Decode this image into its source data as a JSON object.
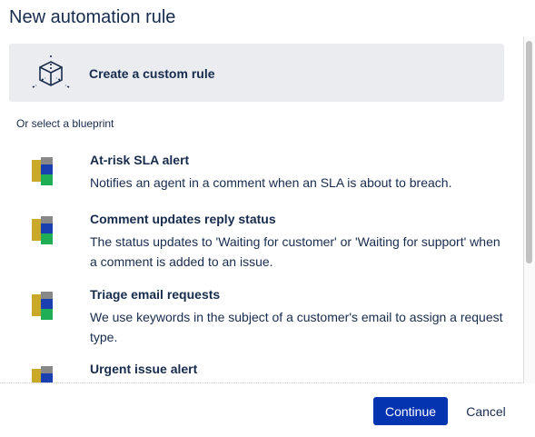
{
  "title": "New automation rule",
  "custom_rule": "Create a custom rule",
  "blueprint_label": "Or select a blueprint",
  "blueprints": [
    {
      "title": "At-risk SLA alert",
      "desc": "Notifies an agent in a comment when an SLA is about to breach."
    },
    {
      "title": "Comment updates reply status",
      "desc": "The status updates to 'Waiting for customer' or 'Waiting for support' when a comment is added to an issue."
    },
    {
      "title": "Triage email requests",
      "desc": "We use keywords in the subject of a customer's email to assign a request type."
    },
    {
      "title": "Urgent issue alert",
      "desc": ""
    }
  ],
  "buttons": {
    "continue": "Continue",
    "cancel": "Cancel"
  }
}
